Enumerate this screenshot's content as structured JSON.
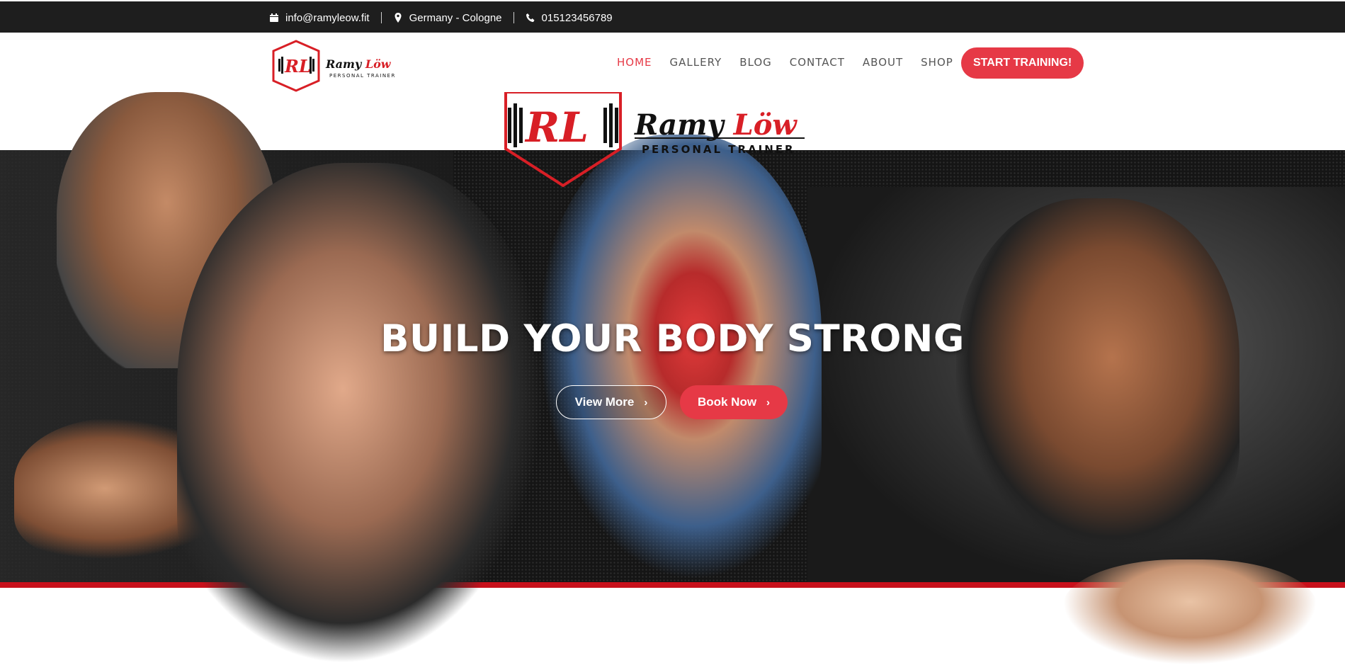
{
  "topbar": {
    "email": "info@ramyleow.fit",
    "location": "Germany - Cologne",
    "phone": "015123456789",
    "icons": [
      "calendar-icon",
      "map-pin-icon",
      "phone-icon"
    ]
  },
  "brand": {
    "initials": "RL",
    "name": "Ramy Löw",
    "tagline": "PERSONAL TRAINER",
    "accent_color": "#e63946",
    "dark_color": "#1e1e1e"
  },
  "nav": {
    "items": [
      {
        "label": "HOME",
        "active": true
      },
      {
        "label": "GALLERY",
        "active": false
      },
      {
        "label": "BLOG",
        "active": false
      },
      {
        "label": "CONTACT",
        "active": false
      },
      {
        "label": "ABOUT",
        "active": false
      },
      {
        "label": "SHOP",
        "active": false
      }
    ],
    "cta_label": "START TRAINING!"
  },
  "hero": {
    "headline": "BUILD YOUR BODY STRONG",
    "primary_button": "View More",
    "secondary_button": "Book Now"
  }
}
